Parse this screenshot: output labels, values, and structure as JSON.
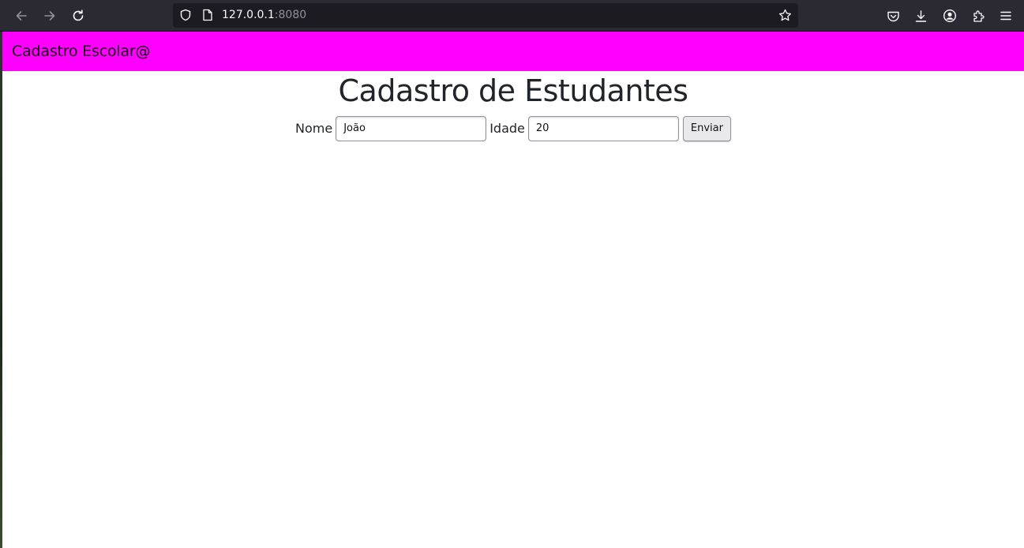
{
  "browser": {
    "url_host": "127.0.0.1",
    "url_port": ":8080"
  },
  "navbar": {
    "brand": "Cadastro Escolar@"
  },
  "main": {
    "title": "Cadastro de Estudantes",
    "form": {
      "name_label": "Nome",
      "name_value": "João",
      "age_label": "Idade",
      "age_value": "20",
      "submit_label": "Enviar"
    }
  },
  "colors": {
    "navbar_bg": "#ff00ff",
    "browser_chrome": "#2b2a33",
    "urlbar_bg": "#1c1b22"
  },
  "icons": {
    "back": "arrow-left-icon",
    "forward": "arrow-right-icon",
    "reload": "reload-icon",
    "tracking": "shield-icon",
    "page": "page-icon",
    "bookmark": "star-icon",
    "pocket": "pocket-icon",
    "downloads": "download-icon",
    "account": "account-icon",
    "extensions": "extensions-icon",
    "menu": "hamburger-menu-icon"
  }
}
